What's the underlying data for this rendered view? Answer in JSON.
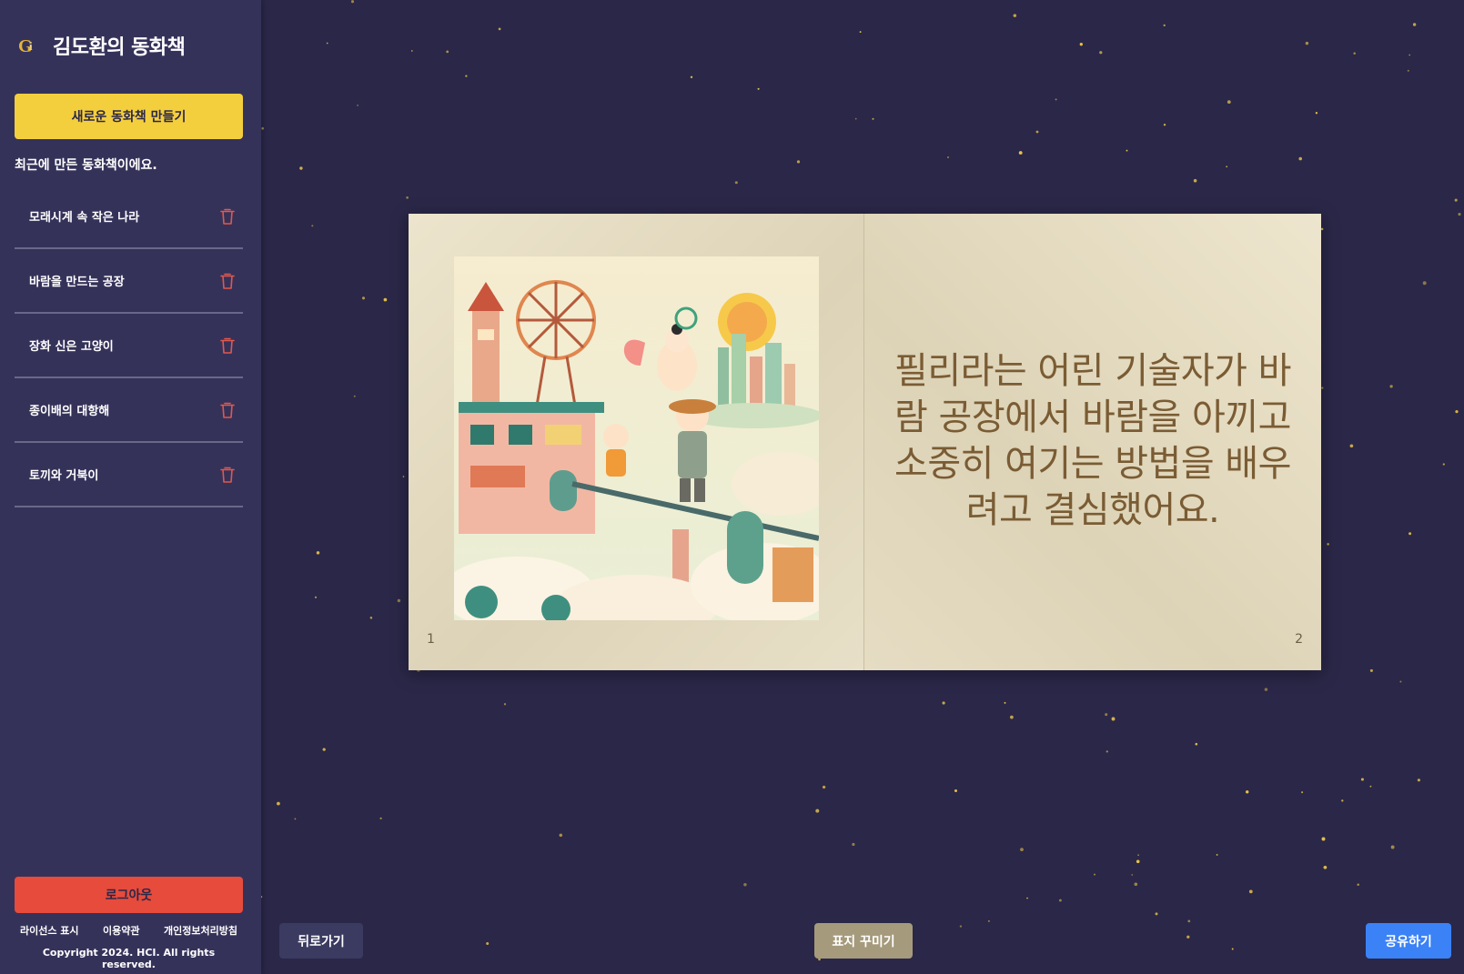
{
  "sidebar": {
    "brand_title": "김도환의 동화책",
    "new_book_label": "새로운 동화책 만들기",
    "recent_label": "최근에 만든 동화책이에요.",
    "books": [
      {
        "title": "모래시계 속 작은 나라"
      },
      {
        "title": "바람을 만드는 공장"
      },
      {
        "title": "장화 신은 고양이"
      },
      {
        "title": "종이배의 대항해"
      },
      {
        "title": "토끼와 거북이"
      }
    ],
    "logout_label": "로그아웃",
    "footer_links": [
      "라이선스 표시",
      "이용약관",
      "개인정보처리방침"
    ],
    "copyright": "Copyright 2024. HCI. All rights reserved."
  },
  "book": {
    "left_page_number": "1",
    "right_page_number": "2",
    "story_text": "필리라는 어린 기술자가 바람 공장에서 바람을 아끼고 소중히 여기는 방법을 배우려고 결심했어요."
  },
  "actions": {
    "back_label": "뒤로가기",
    "cover_label": "표지 꾸미기",
    "share_label": "공유하기"
  },
  "colors": {
    "background": "#2a2748",
    "sidebar": "#35325a",
    "accent_yellow": "#f4cf3d",
    "logout_red": "#e64b3c",
    "share_blue": "#3b82f6",
    "cover_tan": "#a59a7c",
    "trash_red": "#e0584e",
    "star": "#e8c24a"
  }
}
